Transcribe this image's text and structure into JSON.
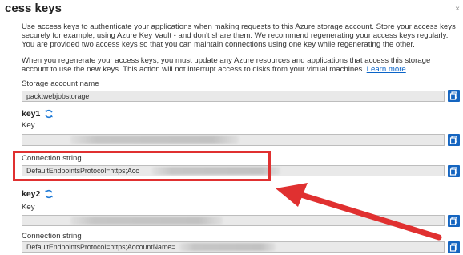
{
  "header": {
    "title": "cess keys",
    "corner": "×"
  },
  "intro": {
    "text": "Use access keys to authenticate your applications when making requests to this Azure storage account. Store your access keys securely for example, using Azure Key Vault - and don't share them. We recommend regenerating your access keys regularly. You are provided two access keys so that you can maintain connections using one key while regenerating the other."
  },
  "regen": {
    "text": "When you regenerate your access keys, you must update any Azure resources and applications that access this storage account to use the new keys. This action will not interrupt access to disks from your virtual machines.",
    "link": "Learn more"
  },
  "account": {
    "label": "Storage account name",
    "value": "packtwebjobstorage"
  },
  "key1": {
    "title": "key1",
    "key_label": "Key",
    "key_value": "",
    "conn_label": "Connection string",
    "conn_value": "DefaultEndpointsProtocol=https;Acc"
  },
  "key2": {
    "title": "key2",
    "key_label": "Key",
    "key_value": "",
    "conn_label": "Connection string",
    "conn_value": "DefaultEndpointsProtocol=https;AccountName="
  },
  "colors": {
    "accent": "#1565c0",
    "highlight": "#e03030",
    "link": "#0a64c8"
  },
  "icons": {
    "copy": "copy-icon",
    "refresh": "refresh-icon"
  }
}
